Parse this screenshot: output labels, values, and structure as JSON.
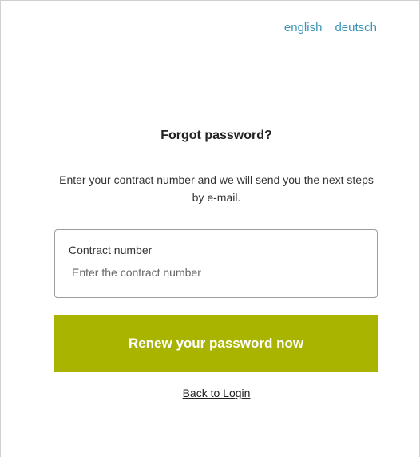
{
  "language_links": {
    "english": "english",
    "deutsch": "deutsch"
  },
  "form": {
    "title": "Forgot password?",
    "instructions": "Enter your contract number and we will send you the next steps by e-mail.",
    "contract_field": {
      "label": "Contract number",
      "value": "",
      "placeholder": "Enter the contract number"
    },
    "submit_label": "Renew your password now",
    "back_link_label": "Back to Login"
  },
  "colors": {
    "accent": "#a9b400",
    "link": "#3a93b8"
  }
}
